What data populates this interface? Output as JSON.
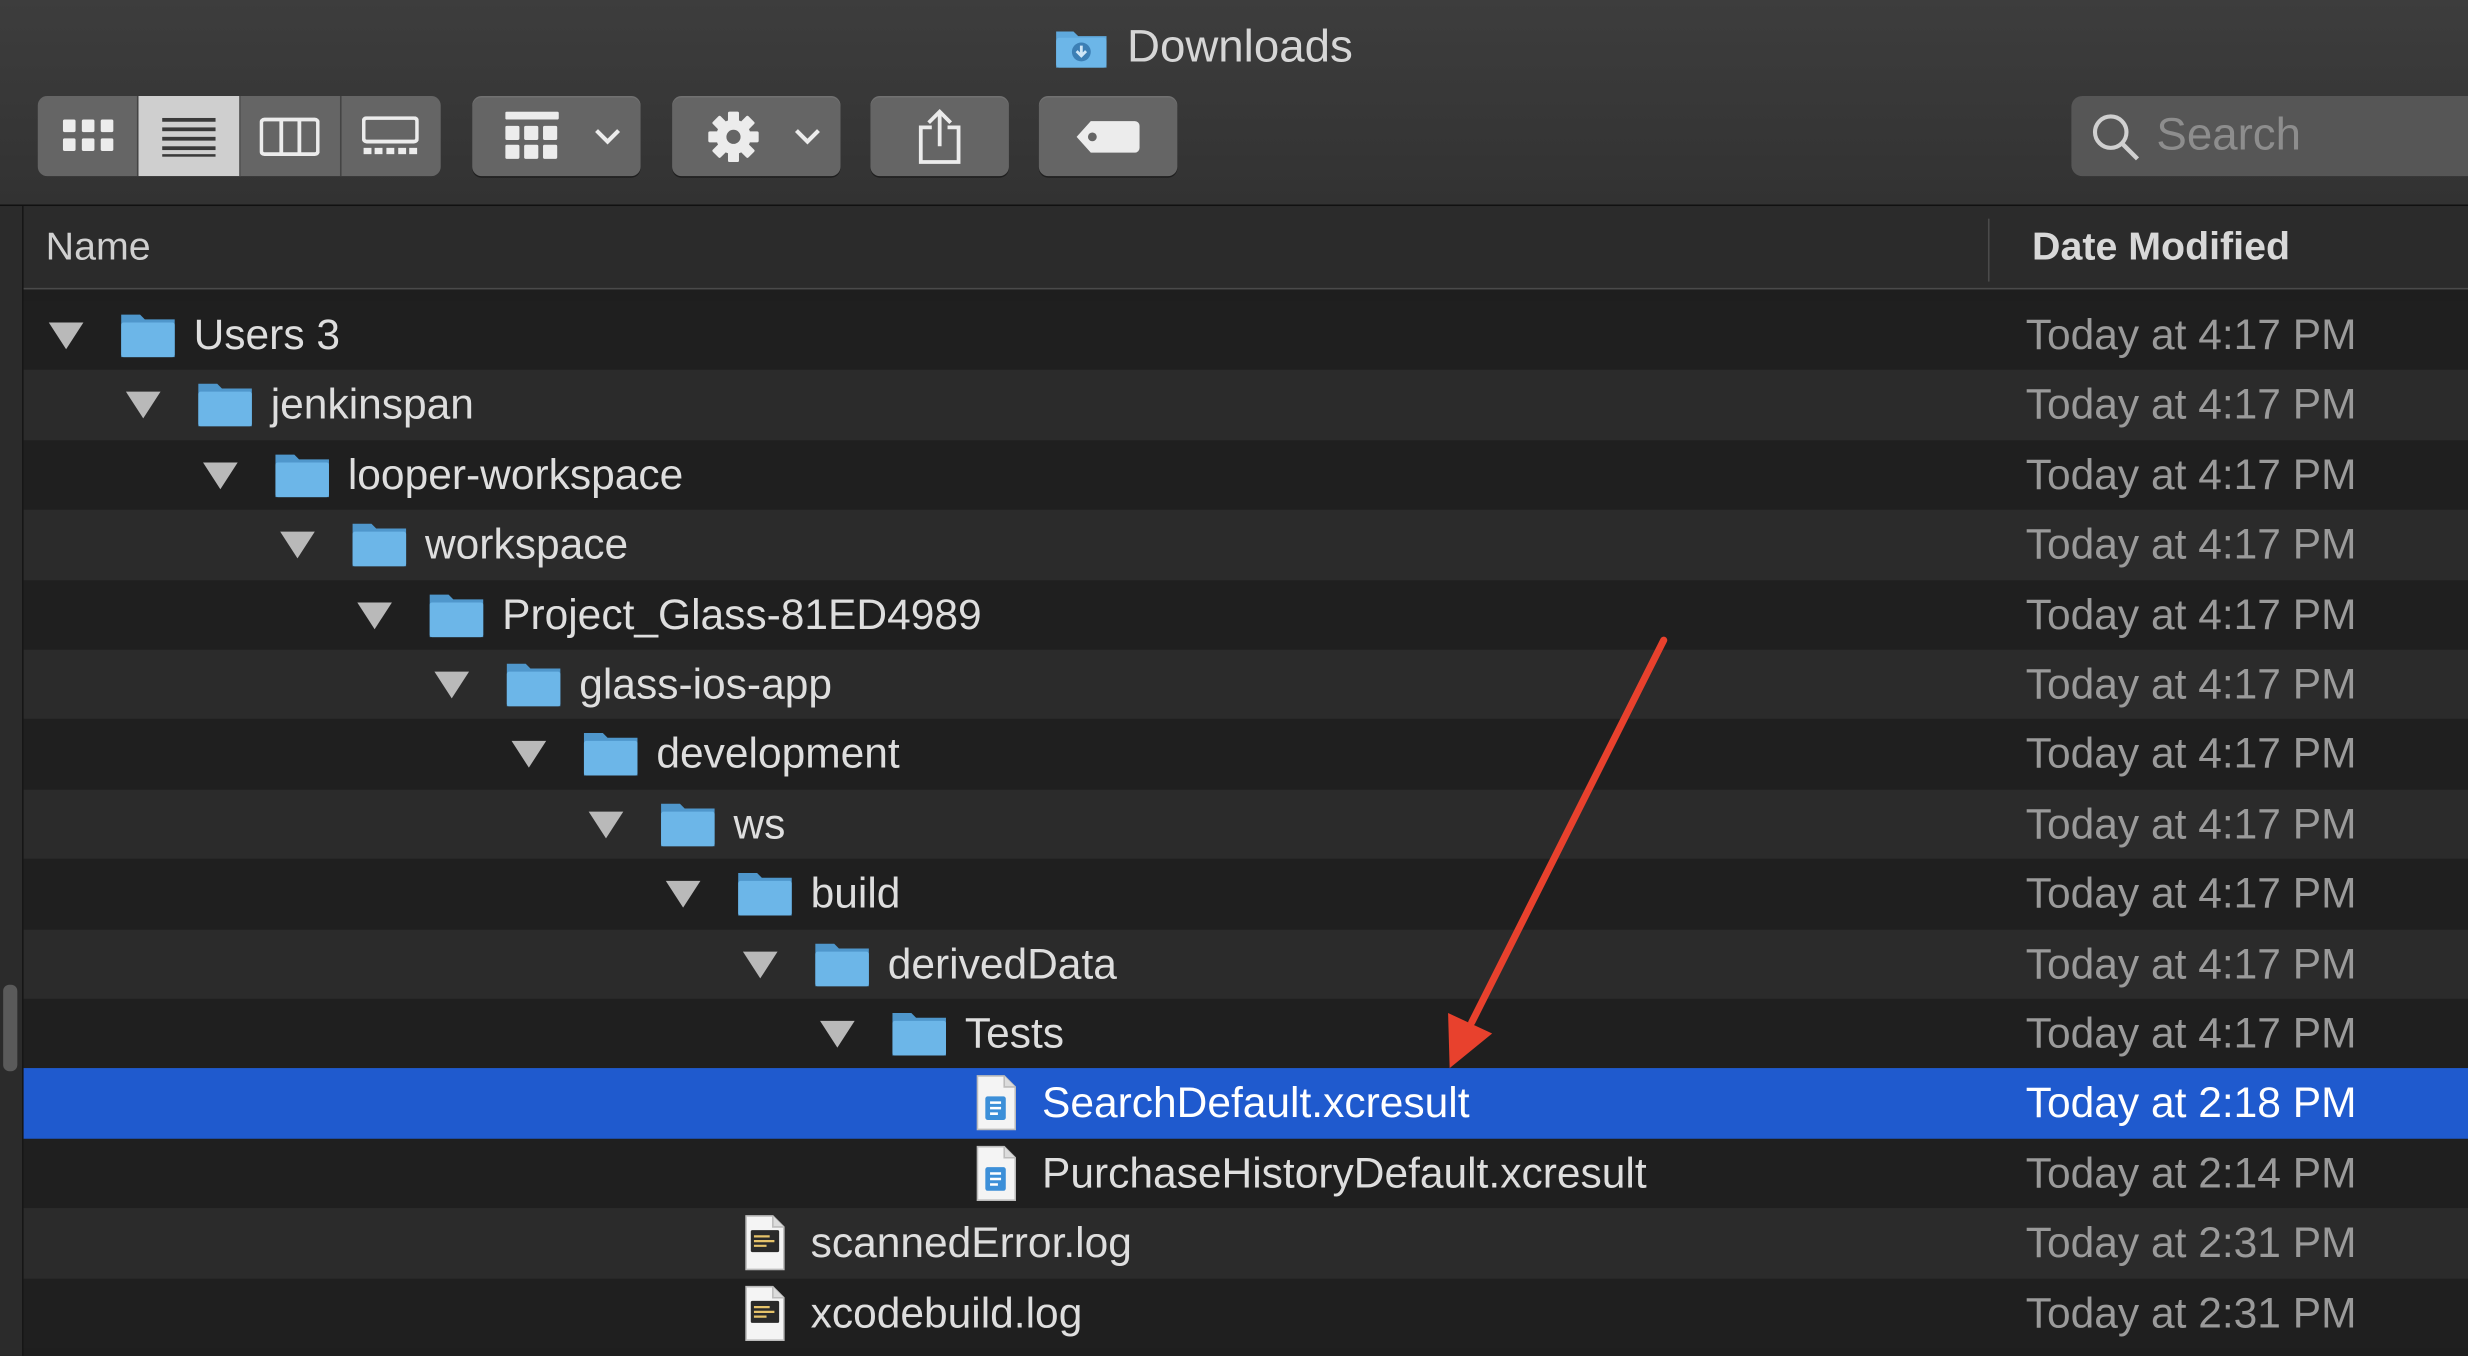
{
  "window": {
    "title": "Downloads"
  },
  "toolbar": {
    "view_modes": [
      "icon-view",
      "list-view",
      "column-view",
      "gallery-view"
    ],
    "active_view": "list-view",
    "group_icon": "group-by-icon",
    "action_icon": "gear-icon",
    "share_icon": "share-icon",
    "tag_icon": "tag-icon"
  },
  "search": {
    "placeholder": "Search"
  },
  "columns": {
    "name": "Name",
    "date": "Date Modified"
  },
  "rows": [
    {
      "name": "Users 3",
      "date": "Today at 4:17 PM",
      "kind": "folder"
    },
    {
      "name": "jenkinspan",
      "date": "Today at 4:17 PM",
      "kind": "folder"
    },
    {
      "name": "looper-workspace",
      "date": "Today at 4:17 PM",
      "kind": "folder"
    },
    {
      "name": "workspace",
      "date": "Today at 4:17 PM",
      "kind": "folder"
    },
    {
      "name": "Project_Glass-81ED4989",
      "date": "Today at 4:17 PM",
      "kind": "folder"
    },
    {
      "name": "glass-ios-app",
      "date": "Today at 4:17 PM",
      "kind": "folder"
    },
    {
      "name": "development",
      "date": "Today at 4:17 PM",
      "kind": "folder"
    },
    {
      "name": "ws",
      "date": "Today at 4:17 PM",
      "kind": "folder"
    },
    {
      "name": "build",
      "date": "Today at 4:17 PM",
      "kind": "folder"
    },
    {
      "name": "derivedData",
      "date": "Today at 4:17 PM",
      "kind": "folder"
    },
    {
      "name": "Tests",
      "date": "Today at 4:17 PM",
      "kind": "folder"
    },
    {
      "name": "SearchDefault.xcresult",
      "date": "Today at 2:18 PM",
      "kind": "xcresult",
      "selected": true
    },
    {
      "name": "PurchaseHistoryDefault.xcresult",
      "date": "Today at 2:14 PM",
      "kind": "xcresult"
    },
    {
      "name": "scannedError.log",
      "date": "Today at 2:31 PM",
      "kind": "log"
    },
    {
      "name": "xcodebuild.log",
      "date": "Today at 2:31 PM",
      "kind": "log"
    }
  ],
  "colors": {
    "selection": "#1f5ace",
    "folder": "#5fa9dd",
    "annotation_arrow": "#e8412d"
  }
}
